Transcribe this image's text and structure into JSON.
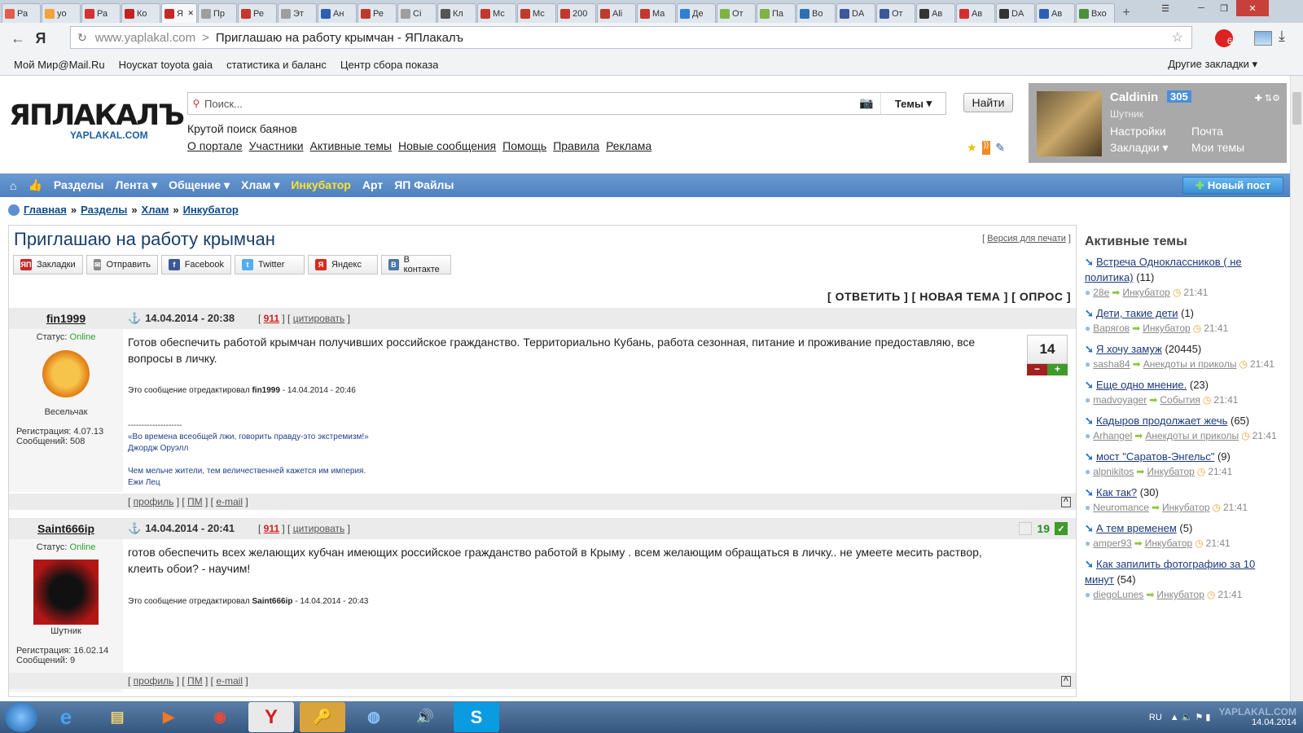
{
  "browser": {
    "tabs": [
      "Ра",
      "yo",
      "Ра",
      "Ко",
      "ЯП",
      "Пр",
      "Ре",
      "Эт",
      "Ан",
      "Ре",
      "Ci",
      "Кл",
      "Мс",
      "Мс",
      "200",
      "Ali",
      "Ма",
      "Де",
      "От",
      "Па",
      "Во",
      "DA",
      "От",
      "Ав",
      "Ав",
      "DA",
      "Ав",
      "Вхо"
    ],
    "url_host": "www.yaplakal.com",
    "url_sep": ">",
    "page_title": "Приглашаю на работу крымчан - ЯПлакалъ",
    "bookmarks": [
      "Мой Мир@Mail.Ru",
      "Ноускат toyota gaia",
      "статистика и баланс",
      "Центр сбора показа"
    ],
    "other_bookmarks": "Другие закладки ▾",
    "ext_badge": "6"
  },
  "header": {
    "logo_main": "ЯПЛАКАЛЪ",
    "logo_sub": "YAPLAKAL.COM",
    "search_placeholder": "Поиск...",
    "themes_label": "Темы",
    "find_button": "Найти",
    "tagline": "Крутой поиск баянов",
    "links": [
      "О портале",
      "Участники",
      "Активные темы",
      "Новые сообщения",
      "Помощь",
      "Правила",
      "Реклама"
    ]
  },
  "user": {
    "name": "Caldinin",
    "reputation": "305",
    "rank": "Шутник",
    "settings": "Настройки",
    "mail": "Почта",
    "bookmarks": "Закладки ▾",
    "my_topics": "Мои темы"
  },
  "nav": {
    "items": [
      "Разделы",
      "Лента ▾",
      "Общение ▾",
      "Хлам ▾",
      "Инкубатор",
      "Арт",
      "ЯП Файлы"
    ],
    "new_post": "Новый пост"
  },
  "breadcrumb": [
    "Главная",
    "Разделы",
    "Хлам",
    "Инкубатор"
  ],
  "breadcrumb_sep": "»",
  "topic": {
    "title": "Приглашаю на работу крымчан",
    "print_link": "Версия для печати",
    "share": [
      "Закладки",
      "Отправить",
      "Facebook",
      "Twitter",
      "Яндекс",
      "В контакте"
    ],
    "actions": "[ ОТВЕТИТЬ ] [ НОВАЯ ТЕМА ] [ ОПРОС ]"
  },
  "posts": [
    {
      "author": "fin1999",
      "date": "14.04.2014 - 20:38",
      "num": "911",
      "quote": "цитировать",
      "status_label": "Статус:",
      "status": "Online",
      "rank": "Весельчак",
      "reg": "Регистрация: 4.07.13",
      "msgs": "Сообщений: 508",
      "body": "Готов обеспечить работой крымчан получивших российское гражданство. Территориально Кубань, работа сезонная, питание и проживание предоставляю, все вопросы в личку.",
      "edited_prefix": "Это сообщение отредактировал",
      "edited_by": "fin1999",
      "edited_date": "- 14.04.2014 - 20:46",
      "sig_line": "--------------------",
      "sig_quote": "«Во времена всеобщей лжи, говорить правду-это экстремизм!»",
      "sig_author": "Джордж Оруэлл",
      "sig_quote2": "Чем мельче жители, тем величественней кажется им империя.",
      "sig_author2": "Ежи Лец",
      "rating": "14",
      "footer": [
        "профиль",
        "ПМ",
        "e-mail"
      ]
    },
    {
      "author": "Saint666ip",
      "date": "14.04.2014 - 20:41",
      "num": "911",
      "quote": "цитировать",
      "status_label": "Статус:",
      "status": "Online",
      "rank": "Шутник",
      "reg": "Регистрация: 16.02.14",
      "msgs": "Сообщений: 9",
      "body": "готов обеспечить всех желающих кубчан имеющих российское гражданство работой в Крыму . всем желающим обращаться в личку.. не умеете месить раствор, клеить обои? - научим!",
      "edited_prefix": "Это сообщение отредактировал",
      "edited_by": "Saint666ip",
      "edited_date": "- 14.04.2014 - 20:43",
      "rating": "19",
      "footer": [
        "профиль",
        "ПМ",
        "e-mail"
      ]
    }
  ],
  "sidebar": {
    "title": "Активные темы",
    "topics": [
      {
        "title": "Встреча Одноклассников ( не политика)",
        "count": "(11)",
        "user": "28e",
        "section": "Инкубатор",
        "time": "21:41"
      },
      {
        "title": "Дети, такие дети",
        "count": "(1)",
        "user": "Варягов",
        "section": "Инкубатор",
        "time": "21:41"
      },
      {
        "title": "Я хочу замуж",
        "count": "(20445)",
        "user": "sasha84",
        "section": "Анекдоты и приколы",
        "time": "21:41"
      },
      {
        "title": "Еще одно мнение.",
        "count": "(23)",
        "user": "madvoyager",
        "section": "События",
        "time": "21:41"
      },
      {
        "title": "Кадыров продолжает жечь",
        "count": "(65)",
        "user": "Arhangel",
        "section": "Анекдоты и приколы",
        "time": "21:41"
      },
      {
        "title": "мост \"Саратов-Энгельс\"",
        "count": "(9)",
        "user": "alpnikitos",
        "section": "Инкубатор",
        "time": "21:41"
      },
      {
        "title": "Как так?",
        "count": "(30)",
        "user": "Neuromance",
        "section": "Инкубатор",
        "time": "21:41"
      },
      {
        "title": "А тем временем",
        "count": "(5)",
        "user": "amper93",
        "section": "Инкубатор",
        "time": "21:41"
      },
      {
        "title": "Как запилить фотографию за 10 минут",
        "count": "(54)",
        "user": "diegoLunes",
        "section": "Инкубатор",
        "time": "21:41"
      }
    ]
  },
  "taskbar": {
    "lang": "RU",
    "date": "14.04.2014",
    "watermark": "YAPLAKAL.COM"
  },
  "colors": {
    "nav_bg": "#5a8ac8",
    "highlight": "#ffe22a",
    "online": "#2aa02a",
    "link": "#1c3a7a"
  }
}
